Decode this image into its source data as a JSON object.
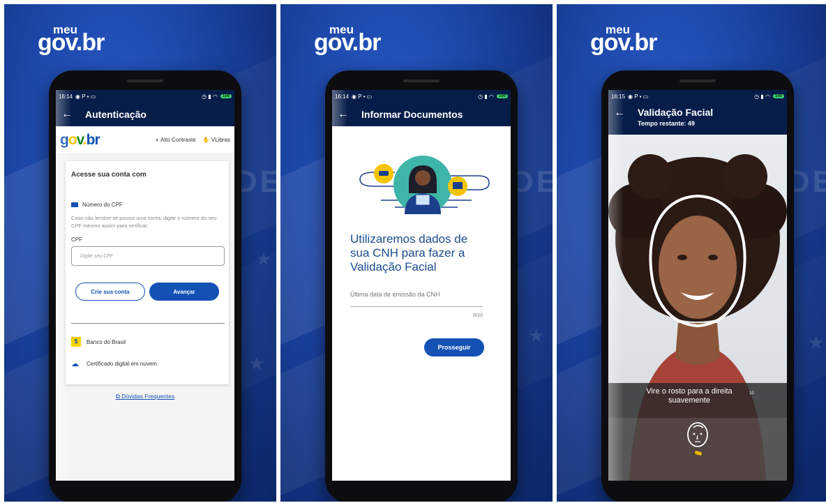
{
  "brand": {
    "meu": "meu",
    "gov": "gov.br"
  },
  "statusbar": {
    "time1": "16:14",
    "time2": "16:14",
    "time3": "16:15",
    "battery": "100"
  },
  "screen1": {
    "title": "Autenticação",
    "logo": "gov.br",
    "high_contrast": "Alto Contraste",
    "vlibras": "VLibras",
    "card_heading": "Acesse sua conta com",
    "cpf_option": "Número do CPF",
    "hint": "Caso não lembre se possui uma conta, digite o número do seu CPF mesmo assim para verificar.",
    "cpf_label": "CPF",
    "cpf_placeholder": "Digite seu CPF",
    "create_account": "Crie sua conta",
    "next": "Avançar",
    "bank": "Banco do Brasil",
    "cloud_cert": "Certificado digital em nuvem",
    "faq": "Dúvidas Frequentes"
  },
  "screen2": {
    "title": "Informar Documentos",
    "heading": "Utilizaremos dados de sua CNH para fazer a Validação Facial",
    "field_label": "Última data de emissão da CNH",
    "counter": "0/10",
    "button": "Prosseguir"
  },
  "screen3": {
    "title": "Validação Facial",
    "timer": "Tempo restante: 49",
    "instruction": "Vire o rosto para a direita suavemente",
    "count": "10"
  },
  "background_text": "DE",
  "colors": {
    "primary": "#1351b4",
    "appbar": "#071d49",
    "gov_yellow": "#f5c400",
    "gov_green": "#168821",
    "brand_bg": "#1c47a8"
  }
}
